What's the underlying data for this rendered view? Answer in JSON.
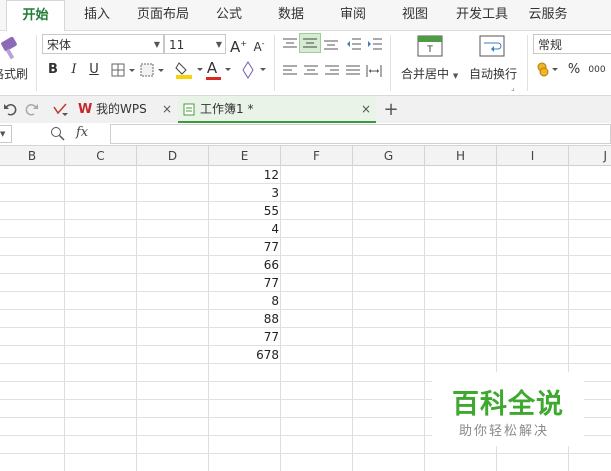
{
  "menu": {
    "tabs": [
      {
        "label": "开始",
        "active": true
      },
      {
        "label": "插入"
      },
      {
        "label": "页面布局"
      },
      {
        "label": "公式"
      },
      {
        "label": "数据"
      },
      {
        "label": "审阅"
      },
      {
        "label": "视图"
      },
      {
        "label": "开发工具"
      },
      {
        "label": "云服务"
      }
    ]
  },
  "ribbon": {
    "format_painter_label": "格式刷",
    "font_name": "宋体",
    "font_size": "11",
    "bold": "B",
    "italic": "I",
    "underline": "U",
    "font_color_glyph": "A",
    "grow_font": "A",
    "shrink_font": "A",
    "merge_center_label": "合并居中",
    "wrap_text_label": "自动换行",
    "number_format": "常规",
    "percent": "%",
    "comma": "000"
  },
  "doc_tabs": {
    "wps_tab": "我的WPS",
    "workbook_tab": "工作簿1 *",
    "close_glyph": "×",
    "add_glyph": "+"
  },
  "formula_bar": {
    "fx_label": "fx",
    "value": ""
  },
  "sheet": {
    "columns": [
      "B",
      "C",
      "D",
      "E",
      "F",
      "G",
      "H",
      "I",
      "J"
    ],
    "column_e_values": [
      "12",
      "3",
      "55",
      "4",
      "77",
      "66",
      "77",
      "8",
      "88",
      "77",
      "678"
    ]
  },
  "watermark": {
    "title": "百科全说",
    "subtitle": "助你轻松解决"
  },
  "colors": {
    "active_tab_text": "#1e7b34",
    "watermark_green": "#3ea82f",
    "font_color_red": "#d9281e",
    "fill_color_yellow": "#f5d50a"
  }
}
